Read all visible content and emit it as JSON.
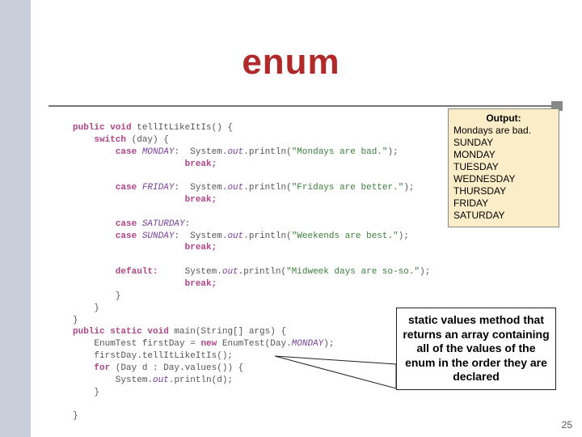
{
  "title": "enum",
  "code": {
    "l1a": "public void",
    "l1b": " tellItLikeItIs() {",
    "l2a": "    switch",
    "l2b": " (day) {",
    "l3a": "        case ",
    "l3b": "MONDAY",
    "l3c": ":  System.",
    "l3d": "out",
    "l3e": ".println(",
    "l3f": "\"Mondays are bad.\"",
    "l3g": ");",
    "l4a": "                     break;",
    "blank1": "",
    "l5a": "        case ",
    "l5b": "FRIDAY",
    "l5c": ":  System.",
    "l5d": "out",
    "l5e": ".println(",
    "l5f": "\"Fridays are better.\"",
    "l5g": ");",
    "l6a": "                     break;",
    "blank2": "",
    "l7a": "        case ",
    "l7b": "SATURDAY",
    "l7c": ":",
    "l8a": "        case ",
    "l8b": "SUNDAY",
    "l8c": ":  System.",
    "l8d": "out",
    "l8e": ".println(",
    "l8f": "\"Weekends are best.\"",
    "l8g": ");",
    "l9a": "                     break;",
    "blank3": "",
    "l10a": "        default:",
    "l10b": "     System.",
    "l10c": "out",
    "l10d": ".println(",
    "l10e": "\"Midweek days are so-so.\"",
    "l10f": ");",
    "l11a": "                     break;",
    "l12": "        }",
    "l13": "    }",
    "l14": "}",
    "l15a": "public static void",
    "l15b": " main(String[] args) {",
    "l16a": "    EnumTest firstDay = ",
    "l16b": "new",
    "l16c": " EnumTest(Day.",
    "l16d": "MONDAY",
    "l16e": ");",
    "l17": "    firstDay.tellItLikeItIs();",
    "l18a": "    for",
    "l18b": " (Day d : Day.values()) {",
    "l19a": "        System.",
    "l19b": "out",
    "l19c": ".println(d);",
    "l20": "    }",
    "blank4": "",
    "l21": "}"
  },
  "output": {
    "header": "Output:",
    "lines": [
      "Mondays are bad.",
      "SUNDAY",
      "MONDAY",
      "TUESDAY",
      "WEDNESDAY",
      "THURSDAY",
      "FRIDAY",
      "SATURDAY"
    ]
  },
  "callout": "static values method that returns an array containing all of the values of the enum in the order they are declared",
  "page": "25"
}
